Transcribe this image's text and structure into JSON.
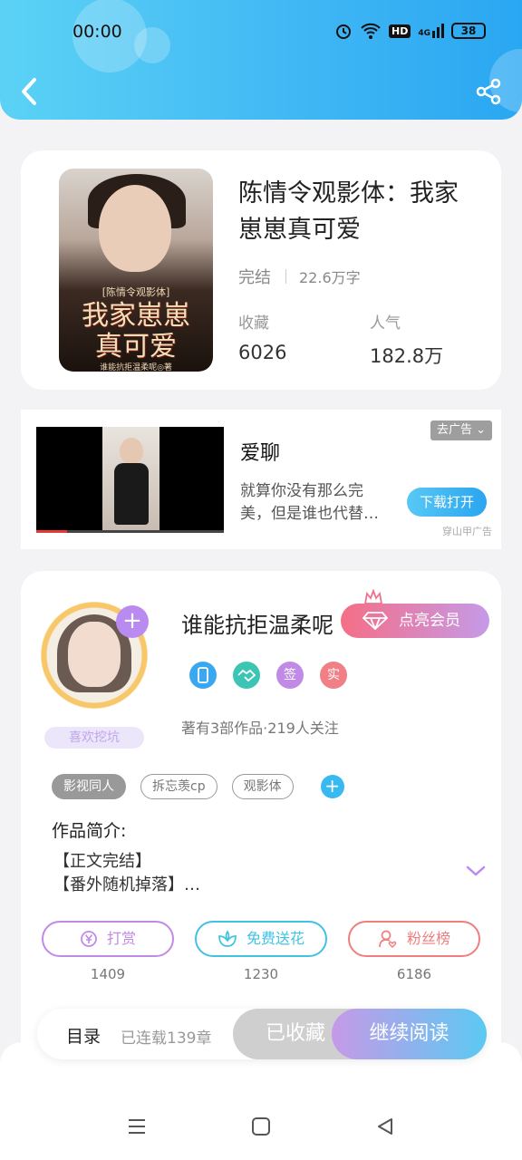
{
  "status_bar": {
    "time": "00:00",
    "battery": "38",
    "network_label": "HD",
    "signal_label": "4G"
  },
  "book": {
    "title": "陈情令观影体：我家崽崽真可爱",
    "status": "完结",
    "words": "22.6万字",
    "collect_label": "收藏",
    "collect_value": "6026",
    "popularity_label": "人气",
    "popularity_value": "182.8万",
    "cover": {
      "series_label": "[陈情令观影体]",
      "title_line1": "我家崽崽",
      "title_line2": "真可爱",
      "author_line": "谁能抗拒温柔呢◎著"
    }
  },
  "ad": {
    "title": "爱聊",
    "description": "就算你没有那么完美，但是谁也代替…",
    "remove_label": "去广告",
    "button_label": "下载打开",
    "source": "穿山甲广告"
  },
  "author": {
    "name": "谁能抗拒温柔呢",
    "vip_label": "点亮会员",
    "avatar_tag": "喜欢挖坑",
    "works": "著有3部作品·219人关注",
    "badges": [
      {
        "label": "",
        "color": "#3aa8f0",
        "icon": "phone-icon"
      },
      {
        "label": "",
        "color": "#3cc4b4",
        "icon": "handshake-icon"
      },
      {
        "label": "签",
        "color": "#c08ae6"
      },
      {
        "label": "实",
        "color": "#f07f86"
      }
    ]
  },
  "tags": [
    "影视同人",
    "拆忘羡cp",
    "观影体"
  ],
  "intro": {
    "label": "作品简介:",
    "line1": "【正文完结】",
    "line2": "【番外随机掉落】…"
  },
  "actions": [
    {
      "label": "打赏",
      "count": "1409",
      "color": "#c08ae6",
      "icon": "yen-icon"
    },
    {
      "label": "免费送花",
      "count": "1230",
      "color": "#3fc3e0",
      "icon": "flower-icon"
    },
    {
      "label": "粉丝榜",
      "count": "6186",
      "color": "#ef7e7e",
      "icon": "fan-icon"
    }
  ],
  "bottom_bar": {
    "toc_label": "目录",
    "chapter_count": "已连载139章",
    "collected_label": "已收藏",
    "read_label": "继续阅读"
  }
}
